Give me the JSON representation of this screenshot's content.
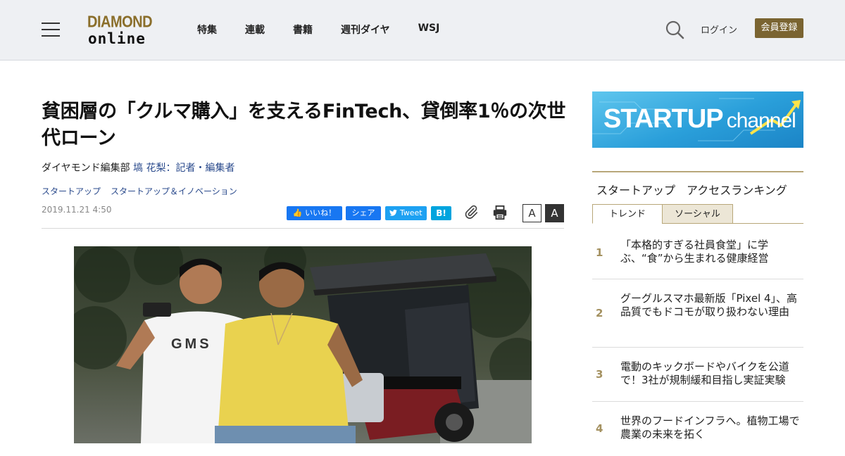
{
  "header": {
    "logo_top": "DIAMOND",
    "logo_bottom": "online",
    "nav": [
      "特集",
      "連載",
      "書籍",
      "週刊ダイヤ",
      "WSJ"
    ],
    "login": "ログイン",
    "register": "会員登録"
  },
  "article": {
    "title": "貧困層の「クルマ購入」を支えるFinTech、貸倒率1％の次世代ローン",
    "byline_org": "ダイヤモンド編集部 ",
    "byline_author": "塙 花梨：記者・編集者",
    "tags": [
      "スタートアップ",
      "スタートアップ＆イノベーション"
    ],
    "date": "2019.11.21 4:50",
    "share": {
      "like": "いいね！",
      "share": "シェア",
      "tweet": "Tweet",
      "hatena": "B!"
    },
    "font_small": "A",
    "font_large": "A",
    "photo_shirt_text": "GMS"
  },
  "sidebar": {
    "banner_bold": "STARTUP",
    "banner_light": "channel",
    "ranking_title": "スタートアップ　アクセスランキング",
    "tabs": [
      "トレンド",
      "ソーシャル"
    ],
    "items": [
      {
        "rank": "1",
        "text": "「本格的すぎる社員食堂」に学ぶ、“食”から生まれる健康経営"
      },
      {
        "rank": "2",
        "text": "グーグルスマホ最新版「Pixel 4」、高品質でもドコモが取り扱わない理由"
      },
      {
        "rank": "3",
        "text": "電動のキックボードやバイクを公道で！3社が規制緩和目指し実証実験"
      },
      {
        "rank": "4",
        "text": "世界のフードインフラへ。植物工場で農業の未来を拓く"
      }
    ]
  },
  "colors": {
    "header_bg": "#eef0f3",
    "brand_gold": "#7a6431",
    "link_blue": "#2a4a8c",
    "facebook": "#1877f2",
    "twitter": "#1da1f2",
    "hatena": "#00a4de"
  }
}
